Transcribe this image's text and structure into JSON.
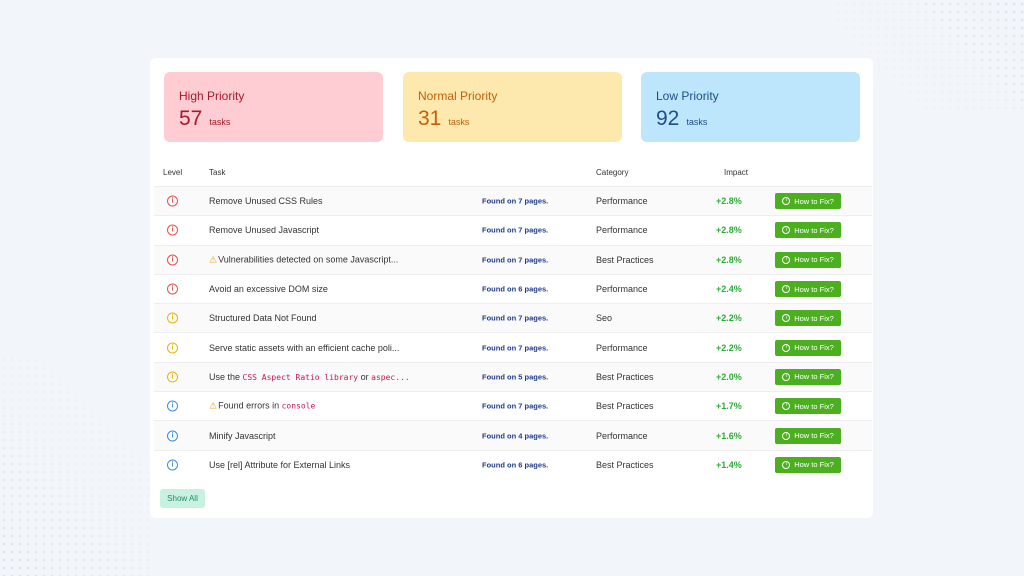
{
  "cards": {
    "high": {
      "title": "High Priority",
      "count": "57",
      "unit": "tasks"
    },
    "normal": {
      "title": "Normal Priority",
      "count": "31",
      "unit": "tasks"
    },
    "low": {
      "title": "Low Priority",
      "count": "92",
      "unit": "tasks"
    }
  },
  "table": {
    "headers": {
      "level": "Level",
      "task": "Task",
      "category": "Category",
      "impact": "Impact"
    },
    "fix_label": "How to Fix?",
    "level_icon": "i",
    "warn_icon": "⚠",
    "rows": [
      {
        "level": "high",
        "task": "Remove Unused CSS Rules",
        "found": "Found on 7 pages.",
        "category": "Performance",
        "impact": "+2.8%"
      },
      {
        "level": "high",
        "task": "Remove Unused Javascript",
        "found": "Found on 7 pages.",
        "category": "Performance",
        "impact": "+2.8%"
      },
      {
        "level": "high",
        "warn": true,
        "task": "Vulnerabilities detected on some Javascript...",
        "found": "Found on 7 pages.",
        "category": "Best Practices",
        "impact": "+2.8%"
      },
      {
        "level": "high",
        "task": "Avoid an excessive DOM size",
        "found": "Found on 6 pages.",
        "category": "Performance",
        "impact": "+2.4%"
      },
      {
        "level": "normal",
        "task": "Structured Data Not Found",
        "found": "Found on 7 pages.",
        "category": "Seo",
        "impact": "+2.2%"
      },
      {
        "level": "normal",
        "task": "Serve static assets with an efficient cache poli...",
        "found": "Found on 7 pages.",
        "category": "Performance",
        "impact": "+2.2%"
      },
      {
        "level": "normal",
        "task_parts": [
          {
            "t": "Use the "
          },
          {
            "t": "CSS Aspect Ratio library",
            "code": true
          },
          {
            "t": " or "
          },
          {
            "t": "aspec...",
            "code": true
          }
        ],
        "found": "Found on 5 pages.",
        "category": "Best Practices",
        "impact": "+2.0%"
      },
      {
        "level": "low",
        "warn": true,
        "task_parts": [
          {
            "t": "Found errors in "
          },
          {
            "t": "console",
            "code": true
          }
        ],
        "found": "Found on 7 pages.",
        "category": "Best Practices",
        "impact": "+1.7%"
      },
      {
        "level": "low",
        "task": "Minify Javascript",
        "found": "Found on 4 pages.",
        "category": "Performance",
        "impact": "+1.6%"
      },
      {
        "level": "low",
        "task": "Use [rel] Attribute for External Links",
        "found": "Found on 6 pages.",
        "category": "Best Practices",
        "impact": "+1.4%"
      }
    ]
  },
  "show_all_label": "Show All"
}
